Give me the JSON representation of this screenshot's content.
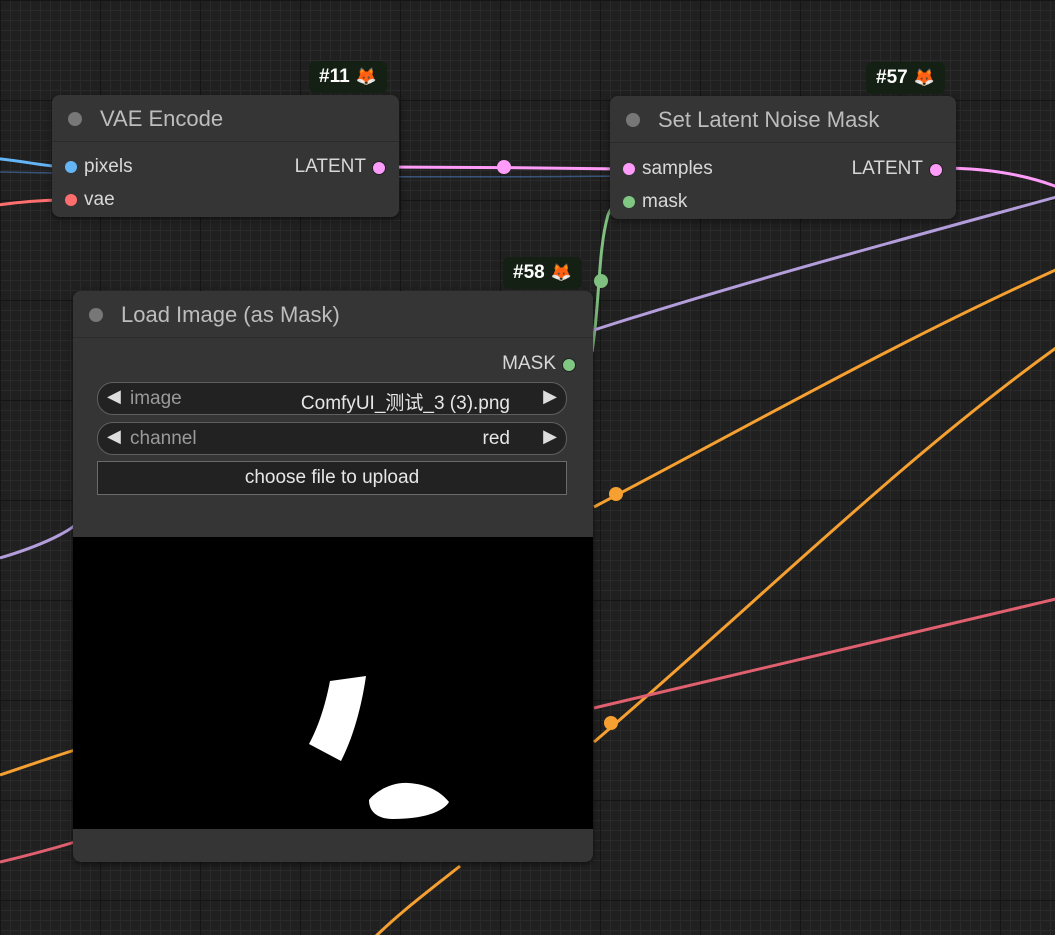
{
  "nodes": {
    "vae_encode": {
      "badge_id": "#11",
      "title": "VAE Encode",
      "inputs": [
        "pixels",
        "vae"
      ],
      "output": "LATENT"
    },
    "set_latent_noise_mask": {
      "badge_id": "#57",
      "title": "Set Latent Noise Mask",
      "inputs": [
        "samples",
        "mask"
      ],
      "output": "LATENT"
    },
    "load_image_mask": {
      "badge_id": "#58",
      "title": "Load Image (as Mask)",
      "output": "MASK",
      "widgets": {
        "image": {
          "label": "image",
          "value": "ComfyUI_测试_3 (3).png"
        },
        "channel": {
          "label": "channel",
          "value": "red"
        }
      },
      "upload_label": "choose file to upload"
    }
  },
  "colors": {
    "image_pin": "#64b5f6",
    "vae_pin": "#ff6e6e",
    "latent_pin": "#ff9cf9",
    "mask_pin": "#81c784",
    "latent_link": "#ff9cf9",
    "mask_link": "#7fbf7f",
    "clip_link": "#b39ddb",
    "orange_link": "#f5a030",
    "red_link": "#e06070"
  },
  "icons": {
    "badge": "fox-icon",
    "widget_prev": "triangle-left-icon",
    "widget_next": "triangle-right-icon"
  }
}
